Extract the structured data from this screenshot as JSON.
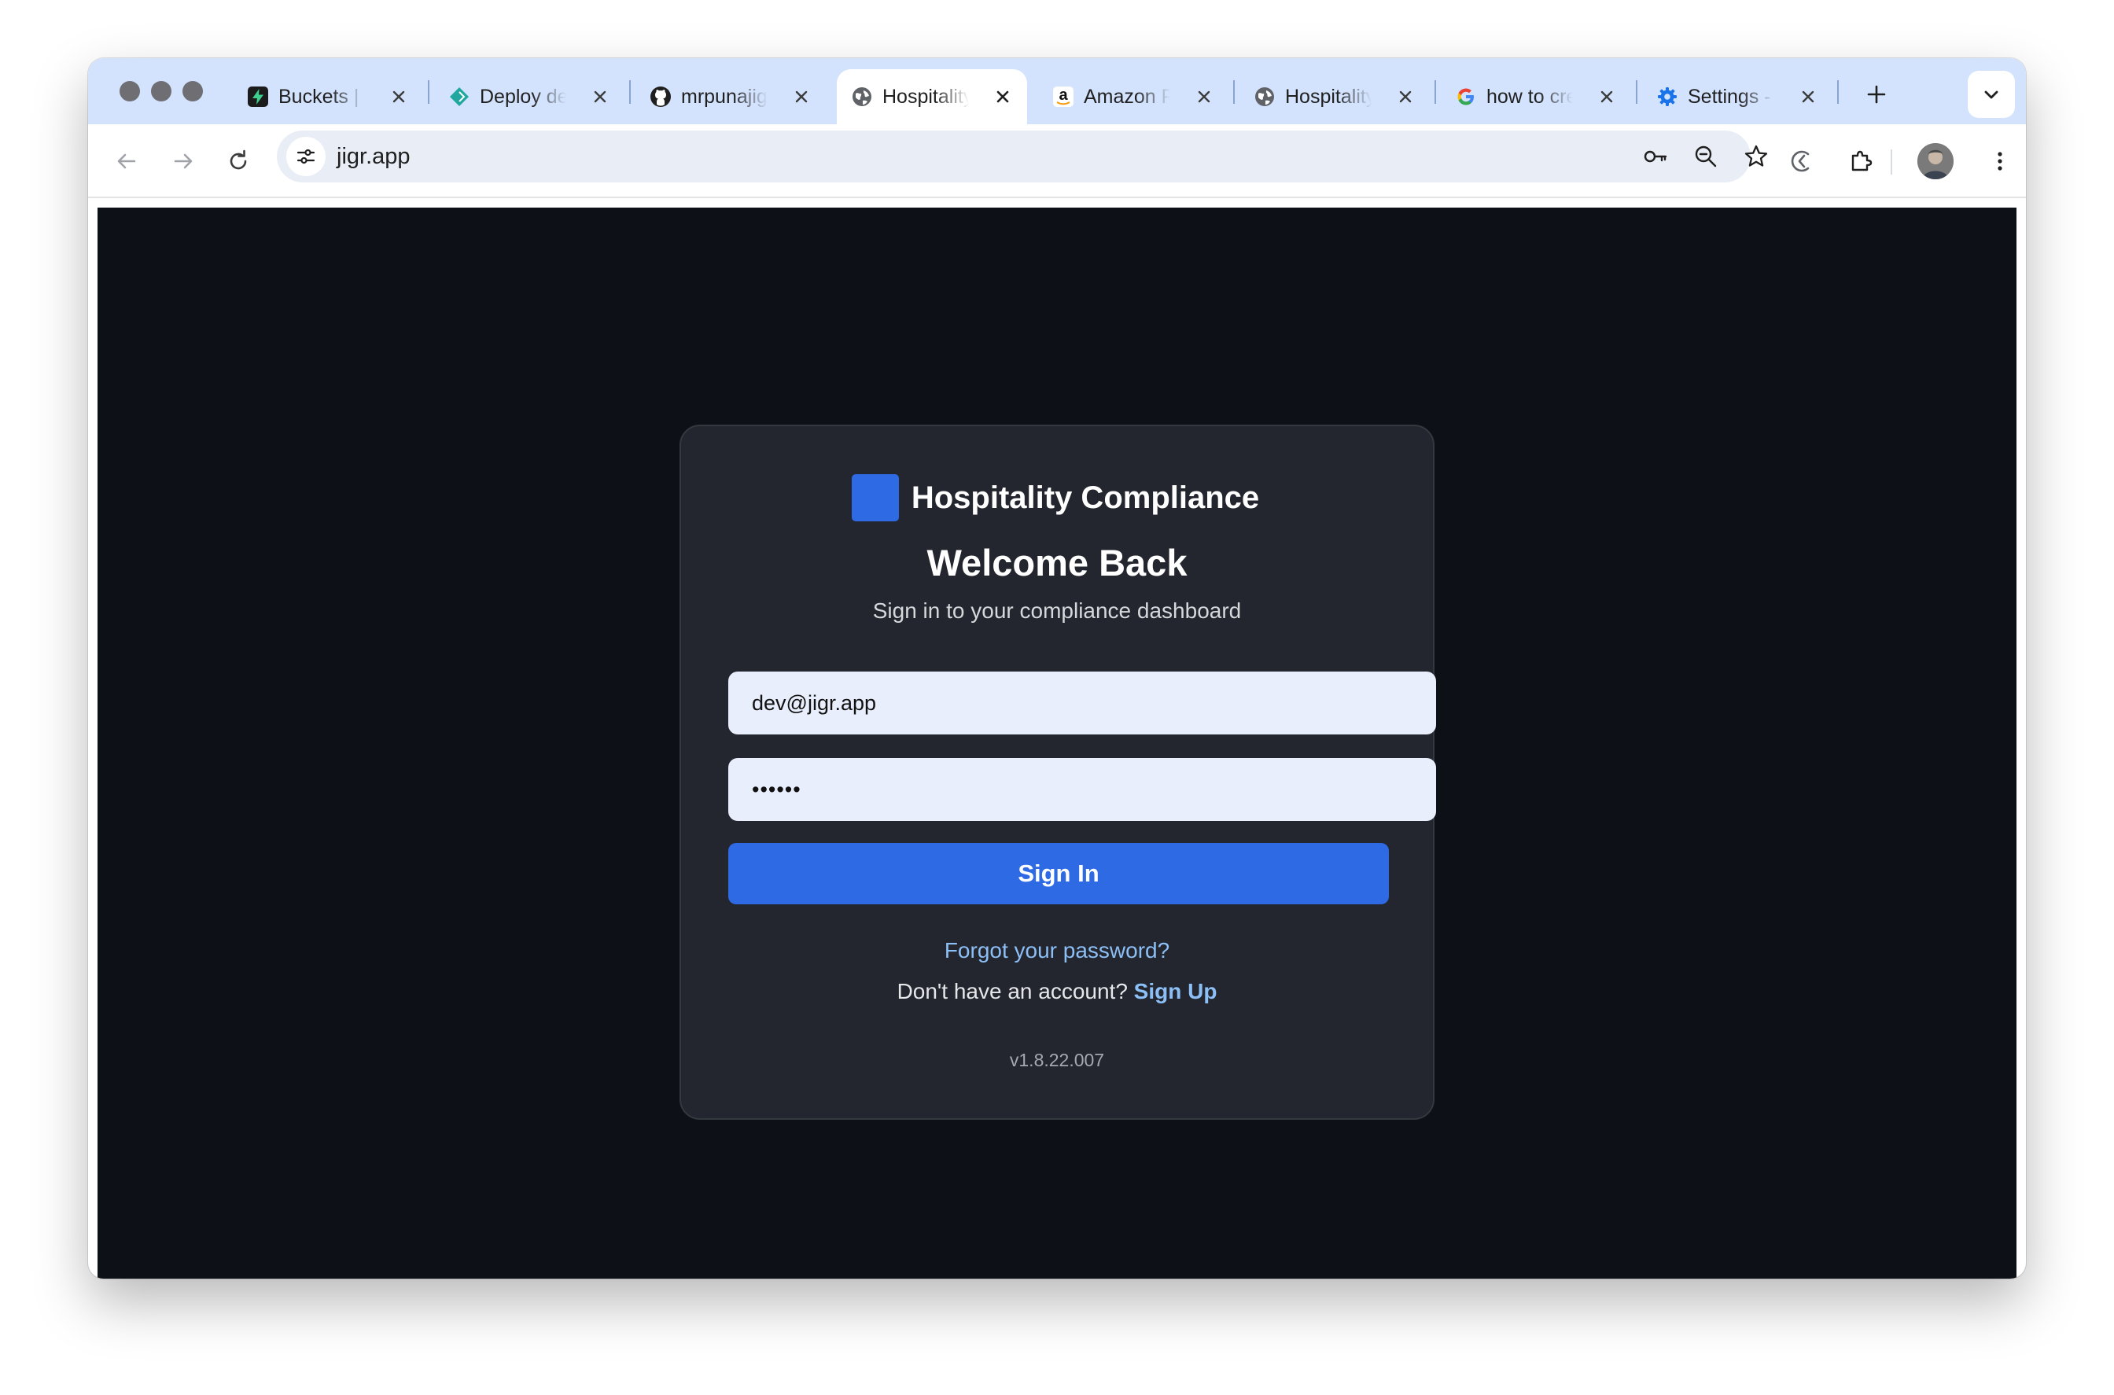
{
  "browser": {
    "tabs": [
      {
        "title": "Buckets | Supabase",
        "icon": "supabase-icon",
        "active": false
      },
      {
        "title": "Deploy details",
        "icon": "netlify-icon",
        "active": false
      },
      {
        "title": "mrpunajig",
        "icon": "github-icon",
        "active": false
      },
      {
        "title": "Hospitality Compliance",
        "icon": "globe-icon",
        "active": true
      },
      {
        "title": "Amazon Prime",
        "icon": "amazon-icon",
        "active": false
      },
      {
        "title": "Hospitality Compliance",
        "icon": "globe-icon",
        "active": false
      },
      {
        "title": "how to create",
        "icon": "google-icon",
        "active": false
      },
      {
        "title": "Settings - Chrome",
        "icon": "gear-icon",
        "active": false
      }
    ],
    "url": "jigr.app"
  },
  "login": {
    "brand_name": "Hospitality Compliance",
    "heading": "Welcome Back",
    "subtitle": "Sign in to your compliance dashboard",
    "email_value": "dev@jigr.app",
    "password_value": "••••••",
    "sign_in_label": "Sign In",
    "forgot_label": "Forgot your password?",
    "no_account_text": "Don't have an account?",
    "sign_up_label": "Sign Up",
    "version": "v1.8.22.007"
  },
  "colors": {
    "tab_strip": "#d3e3fd",
    "page_background": "#0d1117",
    "card_background": "#23262e",
    "accent_blue": "#2d6ae4",
    "link_blue": "#8dbff7",
    "input_background": "#e8eefb"
  }
}
